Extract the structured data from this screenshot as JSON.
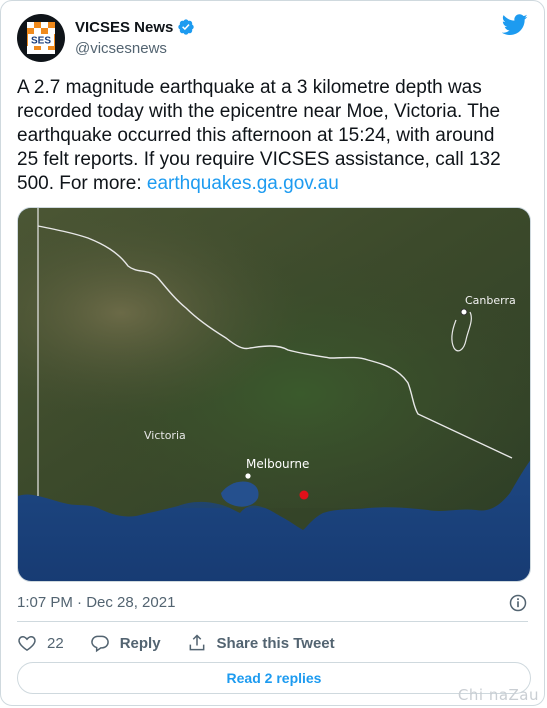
{
  "author": {
    "display_name": "VICSES News",
    "handle": "@vicsesnews",
    "avatar_text": "SES"
  },
  "tweet": {
    "text": "A 2.7 magnitude earthquake at a 3 kilometre depth was recorded today with the epicentre near Moe, Victoria. The earthquake occurred this afternoon at 15:24, with around 25 felt reports. If you require VICSES assistance, call 132 500. For more: ",
    "link_text": "earthquakes.ga.gov.au"
  },
  "map": {
    "labels": {
      "canberra": "Canberra",
      "victoria": "Victoria",
      "melbourne": "Melbourne"
    },
    "colors": {
      "land": "#3d4a2c",
      "sea": "#1f4a86",
      "epicentre": "#e0101a"
    }
  },
  "meta": {
    "timestamp": "1:07 PM · Dec 28, 2021"
  },
  "actions": {
    "like_count": "22",
    "reply_label": "Reply",
    "share_label": "Share this Tweet"
  },
  "read_replies_label": "Read 2 replies",
  "watermark": "Chi naZau",
  "colors": {
    "accent": "#1d9bf0",
    "secondary_text": "#536471"
  }
}
